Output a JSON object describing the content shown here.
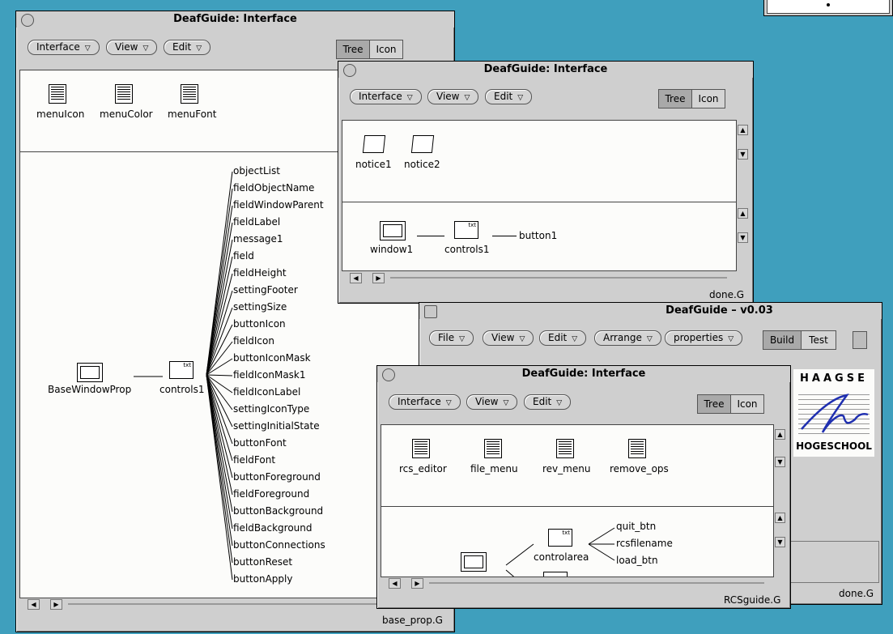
{
  "colors": {
    "desktop": "#3f9fbd",
    "window": "#cfcfcf",
    "pane": "#fcfcfa"
  },
  "win1": {
    "title": "DeafGuide: Interface",
    "menus": [
      "Interface",
      "View",
      "Edit"
    ],
    "modes": {
      "tree": "Tree",
      "icon": "Icon"
    },
    "items": [
      "menuIcon",
      "menuColor",
      "menuFont"
    ],
    "tree": {
      "root": "BaseWindowProp",
      "ctrl": "controls1",
      "children": [
        "objectList",
        "fieldObjectName",
        "fieldWindowParent",
        "fieldLabel",
        "message1",
        "field",
        "fieldHeight",
        "settingFooter",
        "settingSize",
        "buttonIcon",
        "fieldIcon",
        "buttonIconMask",
        "fieldIconMask1",
        "fieldIconLabel",
        "settingIconType",
        "settingInitialState",
        "buttonFont",
        "fieldFont",
        "buttonForeground",
        "fieldForeground",
        "buttonBackground",
        "fieldBackground",
        "buttonConnections",
        "buttonReset",
        "buttonApply"
      ]
    },
    "footer": "base_prop.G"
  },
  "win2": {
    "title": "DeafGuide: Interface",
    "menus": [
      "Interface",
      "View",
      "Edit"
    ],
    "modes": {
      "tree": "Tree",
      "icon": "Icon"
    },
    "items": [
      "notice1",
      "notice2"
    ],
    "tree": {
      "root": "window1",
      "ctrl": "controls1",
      "child": "button1"
    },
    "footer": "done.G"
  },
  "win3": {
    "title": "DeafGuide – v0.03",
    "menus": [
      "File",
      "View",
      "Edit",
      "Arrange",
      "properties"
    ],
    "modes": {
      "build": "Build",
      "test": "Test"
    },
    "logo_top": "HAAGSE",
    "logo_bottom": "HOGESCHOOL",
    "footer": "done.G"
  },
  "win4": {
    "title": "DeafGuide: Interface",
    "menus": [
      "Interface",
      "View",
      "Edit"
    ],
    "modes": {
      "tree": "Tree",
      "icon": "Icon"
    },
    "items": [
      "rcs_editor",
      "file_menu",
      "rev_menu",
      "remove_ops"
    ],
    "tree": {
      "ctrl": "controlarea",
      "children": [
        "quit_btn",
        "rcsfilename",
        "load_btn"
      ]
    },
    "footer": "RCSguide.G"
  },
  "arrows": {
    "down": "▽",
    "up": "▲",
    "dn": "▼",
    "left": "◀",
    "right": "▶"
  }
}
